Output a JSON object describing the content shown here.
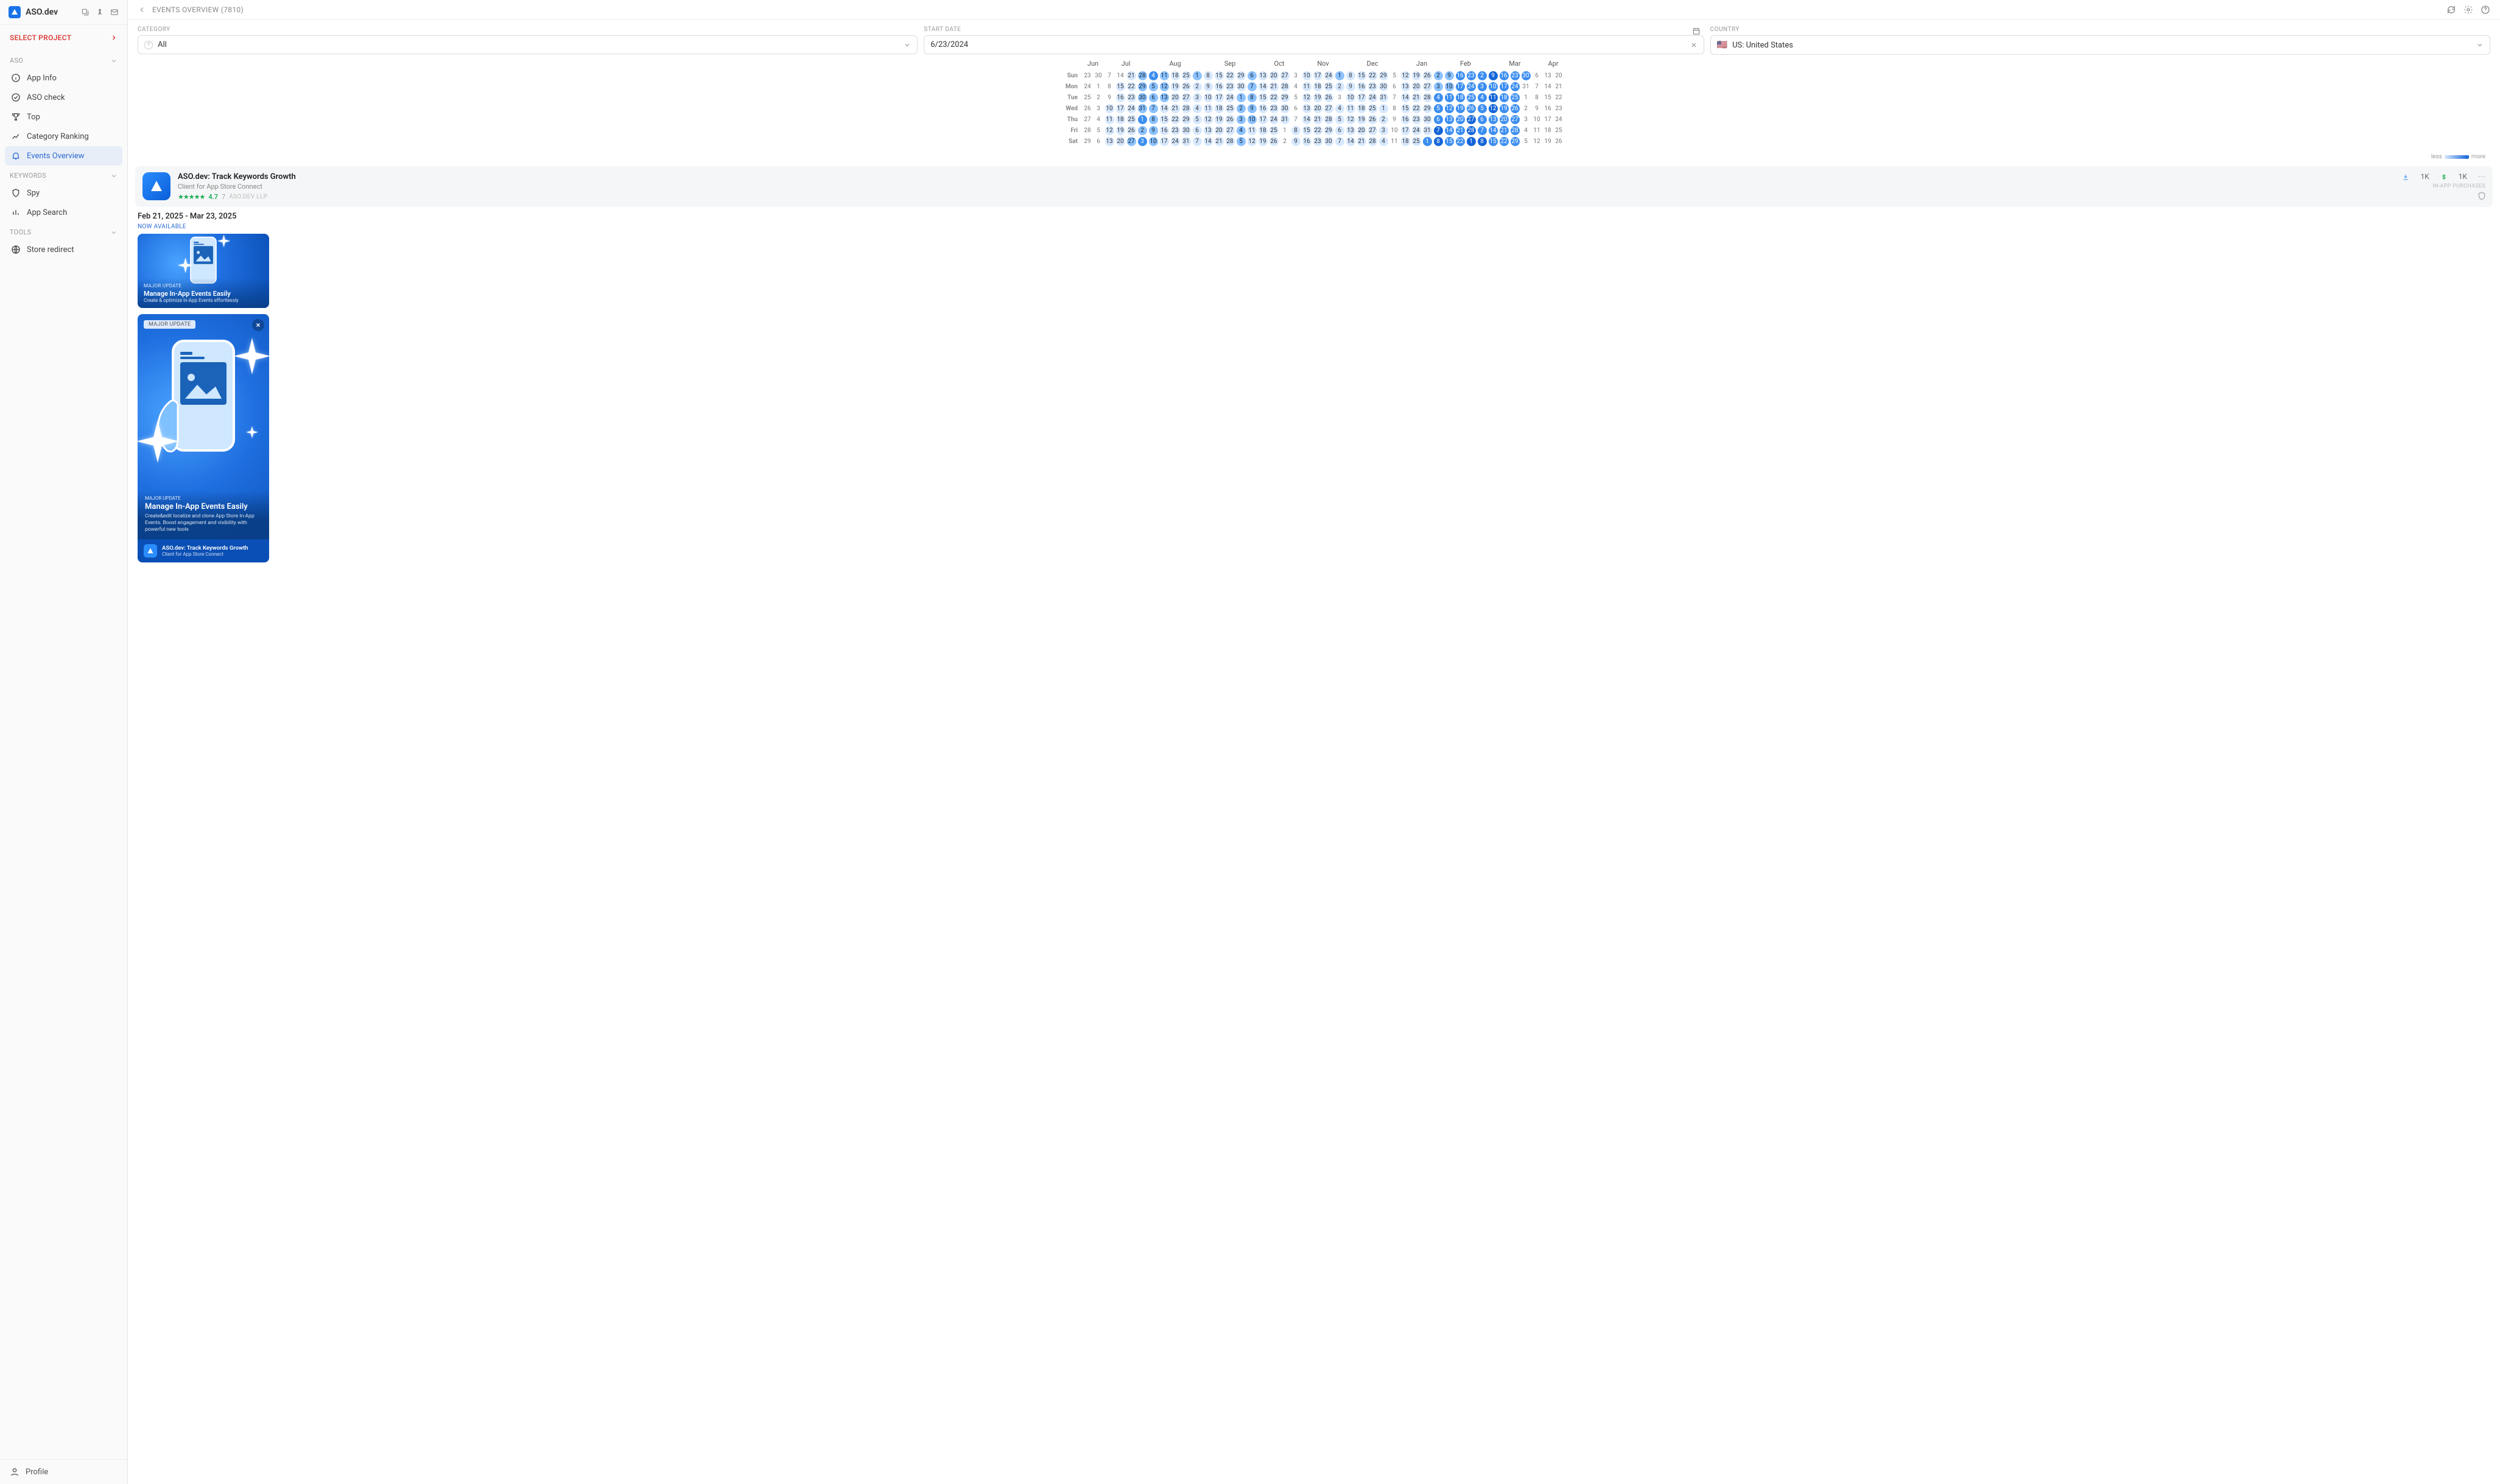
{
  "app": {
    "name": "ASO.dev"
  },
  "select_project": "SELECT PROJECT",
  "sections": {
    "aso": "ASO",
    "keywords": "KEYWORDS",
    "tools": "TOOLS"
  },
  "nav": {
    "app_info": "App Info",
    "aso_check": "ASO check",
    "top": "Top",
    "category_ranking": "Category Ranking",
    "events_overview": "Events Overview",
    "spy": "Spy",
    "app_search": "App Search",
    "store_redirect": "Store redirect"
  },
  "profile": "Profile",
  "page_title": "EVENTS OVERVIEW (7810)",
  "filters": {
    "category_label": "CATEGORY",
    "category_value": "All",
    "start_date_label": "START DATE",
    "start_date_value": "6/23/2024",
    "country_label": "COUNTRY",
    "country_value": "US: United States"
  },
  "heatmap": {
    "months": [
      "Jun",
      "Jul",
      "Aug",
      "Sep",
      "Oct",
      "Nov",
      "Dec",
      "Jan",
      "Feb",
      "Mar",
      "Apr"
    ],
    "month_spans": [
      2,
      4,
      5,
      5,
      4,
      4,
      5,
      4,
      4,
      5,
      4
    ],
    "dows": [
      "Sun",
      "Mon",
      "Tue",
      "Wed",
      "Thu",
      "Fri",
      "Sat"
    ],
    "legend_less": "less",
    "legend_more": "more",
    "cells": [
      [
        [
          "23",
          0
        ],
        [
          "30",
          0
        ],
        [
          "7",
          0
        ],
        [
          "14",
          0
        ],
        [
          "21",
          1
        ],
        [
          "28",
          2
        ],
        [
          "4",
          3
        ],
        [
          "11",
          2
        ],
        [
          "18",
          1
        ],
        [
          "25",
          1
        ],
        [
          "1",
          2
        ],
        [
          "8",
          1
        ],
        [
          "15",
          1
        ],
        [
          "22",
          1
        ],
        [
          "29",
          1
        ],
        [
          "6",
          2
        ],
        [
          "13",
          1
        ],
        [
          "20",
          1
        ],
        [
          "27",
          1
        ],
        [
          "3",
          0
        ],
        [
          "10",
          1
        ],
        [
          "17",
          1
        ],
        [
          "24",
          1
        ],
        [
          "1",
          2
        ],
        [
          "8",
          1
        ],
        [
          "15",
          1
        ],
        [
          "22",
          1
        ],
        [
          "29",
          1
        ],
        [
          "5",
          0
        ],
        [
          "12",
          1
        ],
        [
          "19",
          1
        ],
        [
          "26",
          1
        ],
        [
          "2",
          2
        ],
        [
          "9",
          2
        ],
        [
          "16",
          3
        ],
        [
          "23",
          3
        ],
        [
          "2",
          3
        ],
        [
          "9",
          4
        ],
        [
          "16",
          3
        ],
        [
          "23",
          3
        ],
        [
          "30",
          3
        ],
        [
          "6",
          0
        ],
        [
          "13",
          0
        ],
        [
          "20",
          0
        ]
      ],
      [
        [
          "24",
          0
        ],
        [
          "1",
          0
        ],
        [
          "8",
          0
        ],
        [
          "15",
          1
        ],
        [
          "22",
          1
        ],
        [
          "29",
          2
        ],
        [
          "5",
          2
        ],
        [
          "12",
          2
        ],
        [
          "19",
          1
        ],
        [
          "26",
          1
        ],
        [
          "2",
          1
        ],
        [
          "9",
          1
        ],
        [
          "16",
          1
        ],
        [
          "23",
          1
        ],
        [
          "30",
          1
        ],
        [
          "7",
          2
        ],
        [
          "14",
          1
        ],
        [
          "21",
          1
        ],
        [
          "28",
          1
        ],
        [
          "4",
          0
        ],
        [
          "11",
          1
        ],
        [
          "18",
          1
        ],
        [
          "25",
          1
        ],
        [
          "2",
          1
        ],
        [
          "9",
          1
        ],
        [
          "16",
          1
        ],
        [
          "23",
          1
        ],
        [
          "30",
          1
        ],
        [
          "6",
          0
        ],
        [
          "13",
          1
        ],
        [
          "20",
          1
        ],
        [
          "27",
          1
        ],
        [
          "3",
          2
        ],
        [
          "10",
          2
        ],
        [
          "17",
          3
        ],
        [
          "24",
          3
        ],
        [
          "3",
          3
        ],
        [
          "10",
          3
        ],
        [
          "17",
          3
        ],
        [
          "24",
          3
        ],
        [
          "31",
          0
        ],
        [
          "7",
          0
        ],
        [
          "14",
          0
        ],
        [
          "21",
          0
        ]
      ],
      [
        [
          "25",
          0
        ],
        [
          "2",
          0
        ],
        [
          "9",
          0
        ],
        [
          "16",
          1
        ],
        [
          "23",
          1
        ],
        [
          "30",
          2
        ],
        [
          "6",
          2
        ],
        [
          "13",
          2
        ],
        [
          "20",
          1
        ],
        [
          "27",
          1
        ],
        [
          "3",
          1
        ],
        [
          "10",
          1
        ],
        [
          "17",
          1
        ],
        [
          "24",
          1
        ],
        [
          "1",
          2
        ],
        [
          "8",
          2
        ],
        [
          "15",
          1
        ],
        [
          "22",
          1
        ],
        [
          "29",
          1
        ],
        [
          "5",
          0
        ],
        [
          "12",
          1
        ],
        [
          "19",
          1
        ],
        [
          "26",
          1
        ],
        [
          "3",
          0
        ],
        [
          "10",
          1
        ],
        [
          "17",
          1
        ],
        [
          "24",
          1
        ],
        [
          "31",
          1
        ],
        [
          "7",
          0
        ],
        [
          "14",
          1
        ],
        [
          "21",
          1
        ],
        [
          "28",
          1
        ],
        [
          "4",
          3
        ],
        [
          "11",
          3
        ],
        [
          "18",
          3
        ],
        [
          "25",
          3
        ],
        [
          "4",
          3
        ],
        [
          "11",
          4
        ],
        [
          "18",
          3
        ],
        [
          "25",
          3
        ],
        [
          "1",
          0
        ],
        [
          "8",
          0
        ],
        [
          "15",
          0
        ],
        [
          "22",
          0
        ]
      ],
      [
        [
          "26",
          0
        ],
        [
          "3",
          0
        ],
        [
          "10",
          1
        ],
        [
          "17",
          1
        ],
        [
          "24",
          1
        ],
        [
          "31",
          2
        ],
        [
          "7",
          2
        ],
        [
          "14",
          1
        ],
        [
          "21",
          1
        ],
        [
          "28",
          1
        ],
        [
          "4",
          1
        ],
        [
          "11",
          1
        ],
        [
          "18",
          1
        ],
        [
          "25",
          1
        ],
        [
          "2",
          2
        ],
        [
          "9",
          2
        ],
        [
          "16",
          1
        ],
        [
          "23",
          1
        ],
        [
          "30",
          1
        ],
        [
          "6",
          0
        ],
        [
          "13",
          1
        ],
        [
          "20",
          1
        ],
        [
          "27",
          1
        ],
        [
          "4",
          1
        ],
        [
          "11",
          1
        ],
        [
          "18",
          1
        ],
        [
          "25",
          1
        ],
        [
          "1",
          1
        ],
        [
          "8",
          0
        ],
        [
          "15",
          1
        ],
        [
          "22",
          1
        ],
        [
          "29",
          1
        ],
        [
          "5",
          3
        ],
        [
          "12",
          3
        ],
        [
          "19",
          3
        ],
        [
          "26",
          3
        ],
        [
          "5",
          3
        ],
        [
          "12",
          4
        ],
        [
          "19",
          3
        ],
        [
          "26",
          3
        ],
        [
          "2",
          0
        ],
        [
          "9",
          0
        ],
        [
          "16",
          0
        ],
        [
          "23",
          0
        ]
      ],
      [
        [
          "27",
          0
        ],
        [
          "4",
          0
        ],
        [
          "11",
          1
        ],
        [
          "18",
          1
        ],
        [
          "25",
          1
        ],
        [
          "1",
          3
        ],
        [
          "8",
          2
        ],
        [
          "15",
          1
        ],
        [
          "22",
          1
        ],
        [
          "29",
          1
        ],
        [
          "5",
          1
        ],
        [
          "12",
          1
        ],
        [
          "19",
          1
        ],
        [
          "26",
          1
        ],
        [
          "3",
          2
        ],
        [
          "10",
          2
        ],
        [
          "17",
          1
        ],
        [
          "24",
          1
        ],
        [
          "31",
          1
        ],
        [
          "7",
          0
        ],
        [
          "14",
          1
        ],
        [
          "21",
          1
        ],
        [
          "28",
          1
        ],
        [
          "5",
          1
        ],
        [
          "12",
          1
        ],
        [
          "19",
          1
        ],
        [
          "26",
          1
        ],
        [
          "2",
          1
        ],
        [
          "9",
          0
        ],
        [
          "16",
          1
        ],
        [
          "23",
          1
        ],
        [
          "30",
          1
        ],
        [
          "6",
          3
        ],
        [
          "13",
          3
        ],
        [
          "20",
          3
        ],
        [
          "27",
          4
        ],
        [
          "6",
          3
        ],
        [
          "13",
          3
        ],
        [
          "20",
          3
        ],
        [
          "27",
          3
        ],
        [
          "3",
          0
        ],
        [
          "10",
          0
        ],
        [
          "17",
          0
        ],
        [
          "24",
          0
        ]
      ],
      [
        [
          "28",
          0
        ],
        [
          "5",
          0
        ],
        [
          "12",
          1
        ],
        [
          "19",
          1
        ],
        [
          "26",
          1
        ],
        [
          "2",
          2
        ],
        [
          "9",
          2
        ],
        [
          "16",
          1
        ],
        [
          "23",
          1
        ],
        [
          "30",
          1
        ],
        [
          "6",
          1
        ],
        [
          "13",
          1
        ],
        [
          "20",
          1
        ],
        [
          "27",
          1
        ],
        [
          "4",
          2
        ],
        [
          "11",
          1
        ],
        [
          "18",
          1
        ],
        [
          "25",
          1
        ],
        [
          "1",
          0
        ],
        [
          "8",
          1
        ],
        [
          "15",
          1
        ],
        [
          "22",
          1
        ],
        [
          "29",
          1
        ],
        [
          "6",
          1
        ],
        [
          "13",
          1
        ],
        [
          "20",
          1
        ],
        [
          "27",
          1
        ],
        [
          "3",
          1
        ],
        [
          "10",
          0
        ],
        [
          "17",
          1
        ],
        [
          "24",
          1
        ],
        [
          "31",
          1
        ],
        [
          "7",
          4
        ],
        [
          "14",
          3
        ],
        [
          "21",
          3
        ],
        [
          "28",
          4
        ],
        [
          "7",
          3
        ],
        [
          "14",
          3
        ],
        [
          "21",
          3
        ],
        [
          "28",
          3
        ],
        [
          "4",
          0
        ],
        [
          "11",
          0
        ],
        [
          "18",
          0
        ],
        [
          "25",
          0
        ]
      ],
      [
        [
          "29",
          0
        ],
        [
          "6",
          0
        ],
        [
          "13",
          1
        ],
        [
          "20",
          1
        ],
        [
          "27",
          2
        ],
        [
          "3",
          3
        ],
        [
          "10",
          2
        ],
        [
          "17",
          1
        ],
        [
          "24",
          1
        ],
        [
          "31",
          1
        ],
        [
          "7",
          1
        ],
        [
          "14",
          1
        ],
        [
          "21",
          1
        ],
        [
          "28",
          1
        ],
        [
          "5",
          2
        ],
        [
          "12",
          1
        ],
        [
          "19",
          1
        ],
        [
          "26",
          1
        ],
        [
          "2",
          0
        ],
        [
          "9",
          1
        ],
        [
          "16",
          1
        ],
        [
          "23",
          1
        ],
        [
          "30",
          1
        ],
        [
          "7",
          1
        ],
        [
          "14",
          1
        ],
        [
          "21",
          1
        ],
        [
          "28",
          1
        ],
        [
          "4",
          1
        ],
        [
          "11",
          0
        ],
        [
          "18",
          1
        ],
        [
          "25",
          1
        ],
        [
          "1",
          3
        ],
        [
          "8",
          4
        ],
        [
          "15",
          3
        ],
        [
          "22",
          3
        ],
        [
          "1",
          4
        ],
        [
          "8",
          4
        ],
        [
          "15",
          3
        ],
        [
          "22",
          3
        ],
        [
          "29",
          3
        ],
        [
          "5",
          0
        ],
        [
          "12",
          0
        ],
        [
          "19",
          0
        ],
        [
          "26",
          0
        ]
      ]
    ]
  },
  "app_card": {
    "title": "ASO.dev: Track Keywords Growth",
    "subtitle": "Client for App Store Connect",
    "rating": "4.7",
    "rating_count": "7",
    "developer": "ASO.DEV LLP",
    "downloads": "1K",
    "revenue": "1K",
    "iap": "IN-APP PURCHASES"
  },
  "event": {
    "date_range": "Feb 21, 2025 - Mar 23, 2025",
    "now_available": "NOW AVAILABLE",
    "tag": "MAJOR UPDATE",
    "headline": "Manage In-App Events Easily",
    "desc_short": "Create & optimize In-App Events effortlessly",
    "desc_long": "Create&edit localize and clone App Store In-App Events. Boost engagement and visibility with powerful new tools",
    "footer_title": "ASO.dev: Track Keywords Growth",
    "footer_sub": "Client for App Store Connect"
  }
}
